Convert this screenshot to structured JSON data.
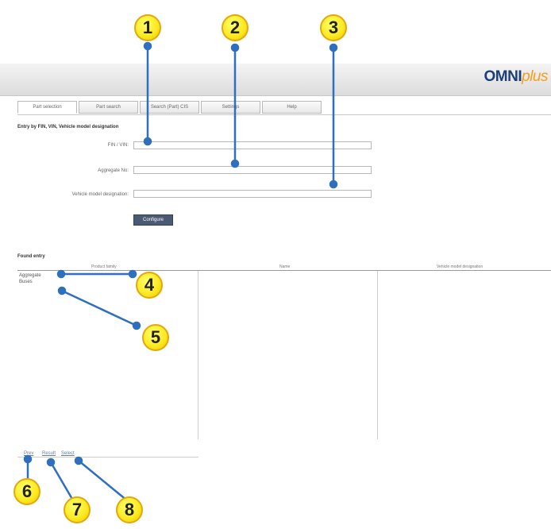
{
  "logo": {
    "part1": "OMNI",
    "part2": "plus"
  },
  "tabs": [
    {
      "label": "Part selection",
      "active": true
    },
    {
      "label": "Part search",
      "active": false
    },
    {
      "label": "Search (Part) CIS",
      "active": false
    },
    {
      "label": "Settings",
      "active": false
    },
    {
      "label": "Help",
      "active": false
    }
  ],
  "section_title": "Entry by FIN, VIN, Vehicle model designation",
  "form": {
    "fin_vin_label": "FIN / VIN:",
    "aggregate_no_label": "Aggregate No:",
    "vehicle_model_label": "Vehicle model designation:",
    "fin_vin_value": "",
    "aggregate_no_value": "",
    "vehicle_model_value": "",
    "button_label": "Configure"
  },
  "results": {
    "title": "Found entry",
    "columns": [
      "Product family",
      "Name",
      "Vehicle model designation"
    ],
    "items": [
      "Aggregate",
      "Buses"
    ]
  },
  "pager": {
    "first": "Prev",
    "second": "Result",
    "third": "Select"
  },
  "callouts": [
    "1",
    "2",
    "3",
    "4",
    "5",
    "6",
    "7",
    "8"
  ],
  "colors": {
    "accent": "#fbe81e",
    "connector": "#2f6fc0",
    "button": "#4a5a73"
  }
}
